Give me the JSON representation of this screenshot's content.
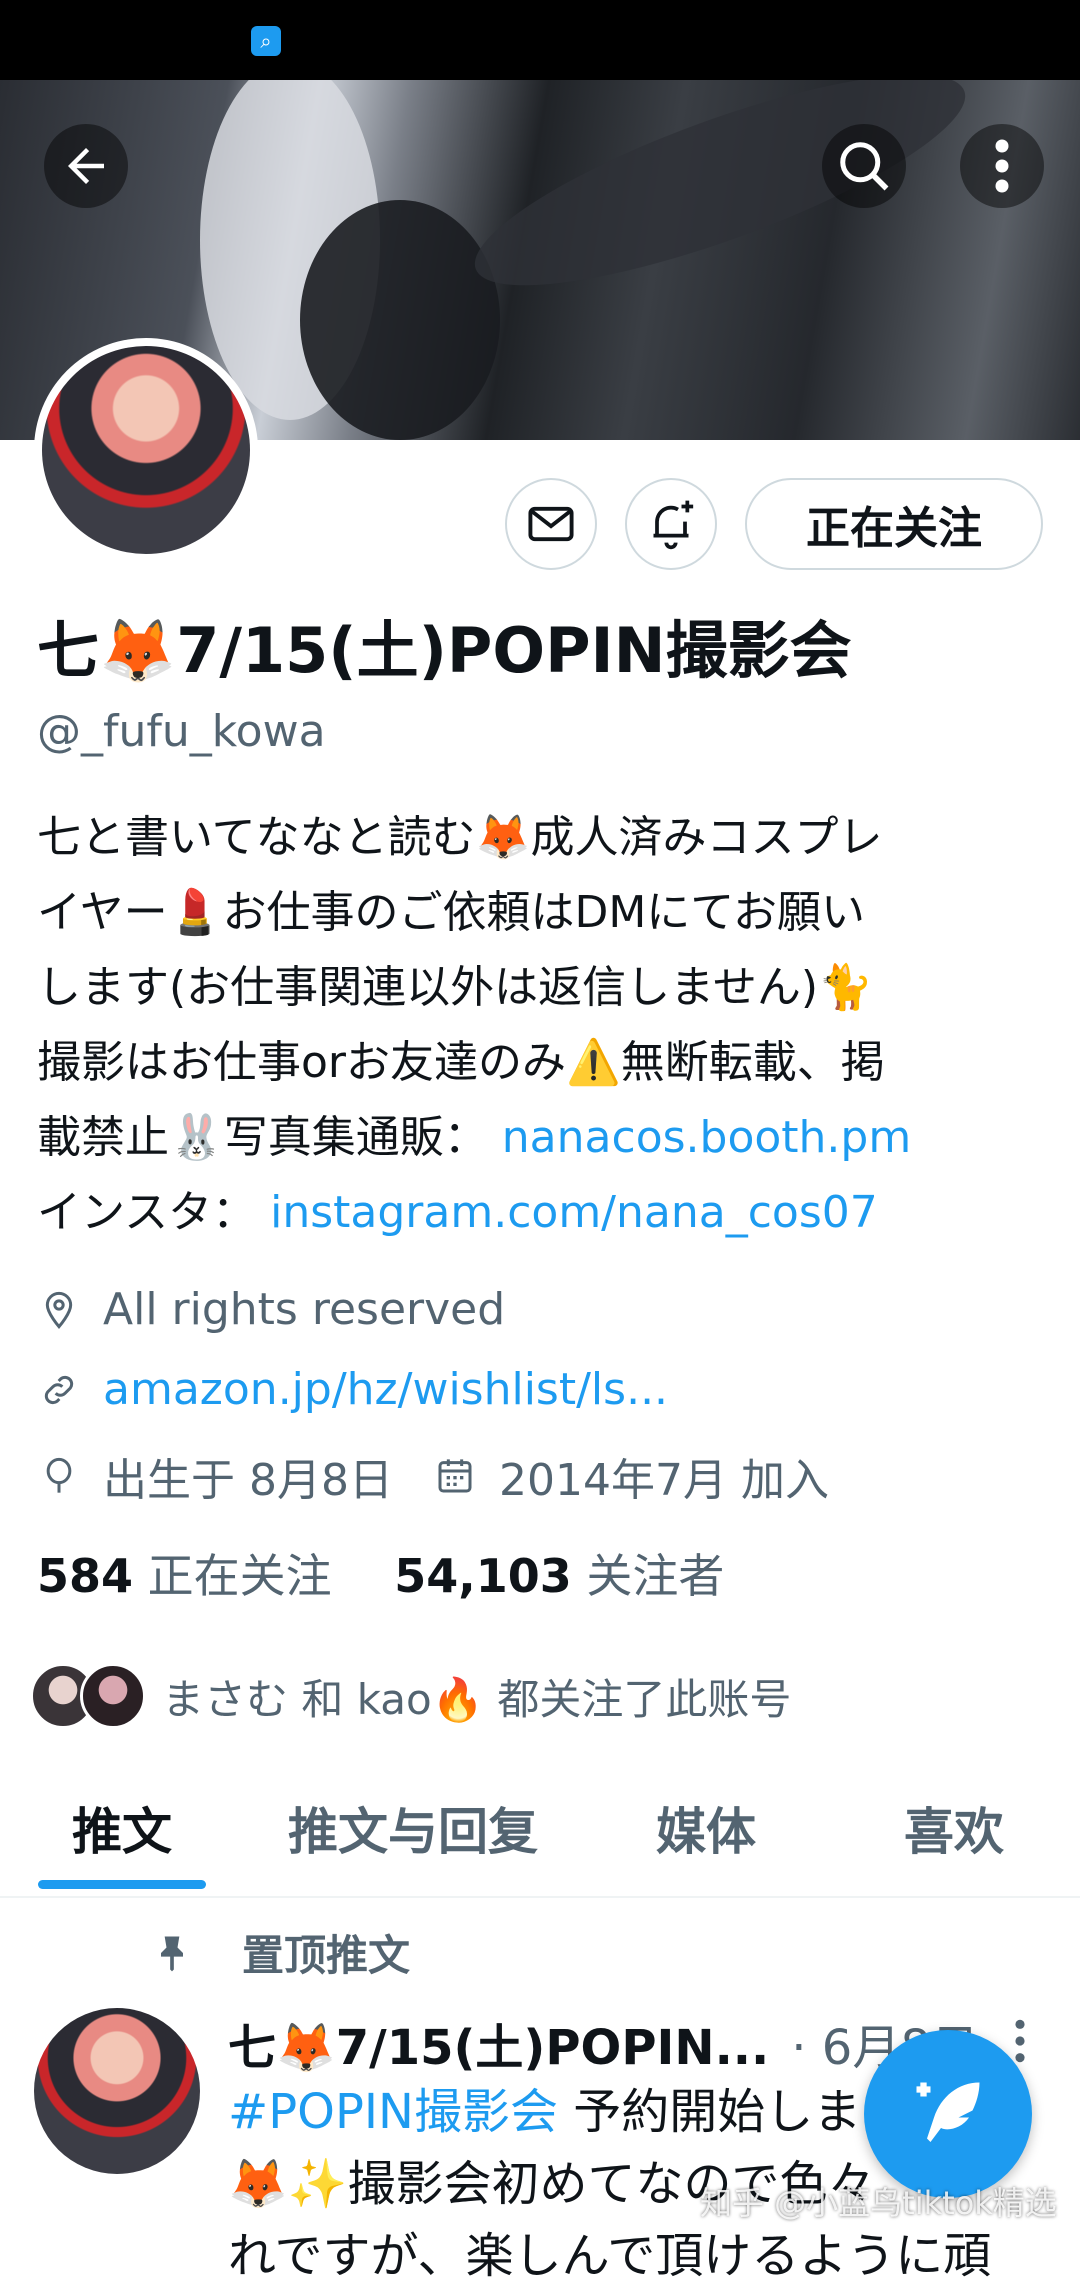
{
  "profile": {
    "display_name": "七🦊7/15(土)POPIN撮影会",
    "handle": "@_fufu_kowa",
    "follow_button": "正在关注",
    "bio_lines": [
      "七と書いてななと読む🦊成人済みコスプレ",
      "イヤー💄お仕事のご依頼はDMにてお願い",
      "します(お仕事関連以外は返信しません)🐈",
      "撮影はお仕事orお友達のみ⚠️無断転載、掲"
    ],
    "bio_line5_text": "載禁止🐰写真集通販：",
    "bio_line5_link": "nanacos.booth.pm",
    "bio_line6_text": "インスタ：",
    "bio_line6_link": "instagram.com/nana_cos07",
    "location": "All rights reserved",
    "website": "amazon.jp/hz/wishlist/ls...",
    "birthday": "出生于 8月8日",
    "joined": "2014年7月 加入",
    "following_count": "584",
    "following_label": "正在关注",
    "followers_count": "54,103",
    "followers_label": "关注者",
    "followed_by_text": "まさむ 和 kao🔥 都关注了此账号"
  },
  "tabs": [
    {
      "label": "推文",
      "active": true
    },
    {
      "label": "推文与回复",
      "active": false
    },
    {
      "label": "媒体",
      "active": false
    },
    {
      "label": "喜欢",
      "active": false
    }
  ],
  "pinned_tweet": {
    "pinned_label": "置顶推文",
    "author": "七🦊7/15(土)POPIN...",
    "date": "· 6月8日",
    "hashtag": "#POPIN撮影会",
    "text_line1_rest": " 予約開始しま",
    "text_line2": "🦊✨撮影会初めてなので色々",
    "text_line3": "れですが、楽しんで頂けるように頑"
  },
  "watermark": "知乎 @小蓝鸟tiktok精选",
  "colors": {
    "accent": "#1d9bf0",
    "secondary_text": "#536471",
    "primary_text": "#0f1419"
  },
  "icons": [
    "back-arrow-icon",
    "search-icon",
    "more-vert-icon",
    "mail-icon",
    "bell-plus-icon",
    "location-pin-icon",
    "link-icon",
    "balloon-icon",
    "calendar-icon",
    "pin-icon",
    "compose-feather-icon"
  ]
}
